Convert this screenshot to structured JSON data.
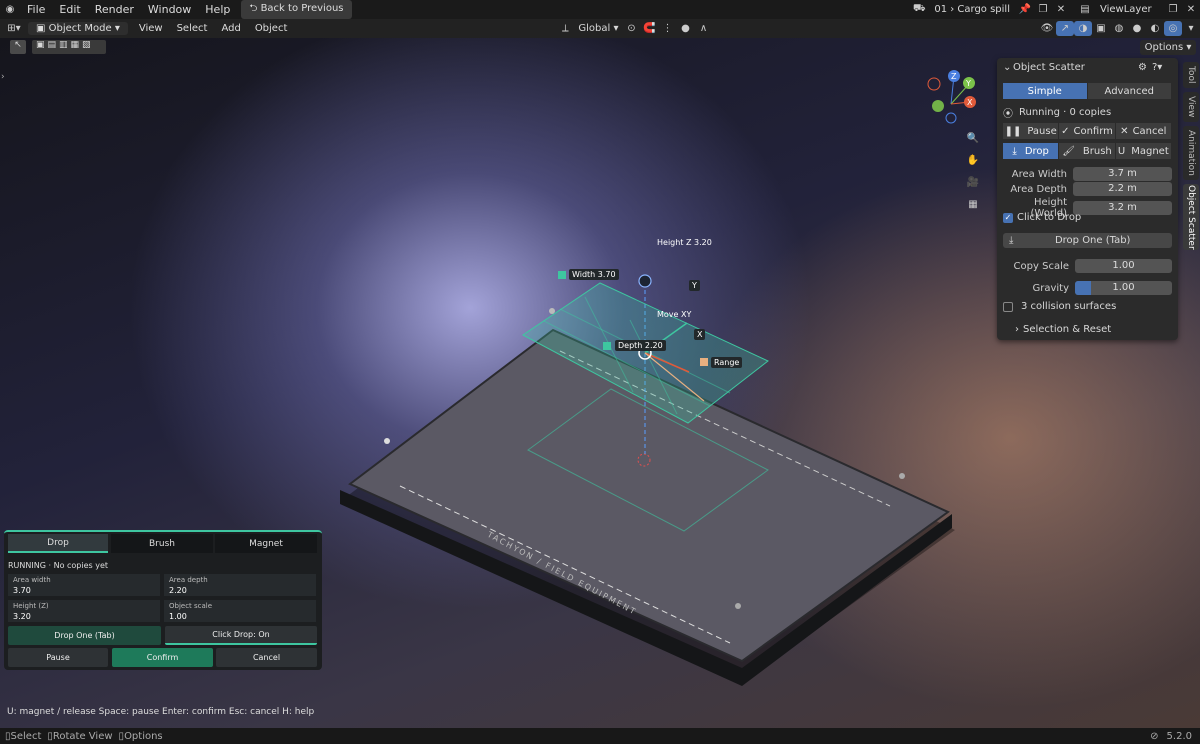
{
  "menu": {
    "items": [
      "File",
      "Edit",
      "Render",
      "Window",
      "Help"
    ],
    "back_button": "Back to Previous",
    "scene": "01 › Cargo spill",
    "view_layer": "ViewLayer"
  },
  "header": {
    "mode": "Object Mode",
    "menus": [
      "View",
      "Select",
      "Add",
      "Object"
    ],
    "orientation": "Global",
    "options": "Options"
  },
  "panel": {
    "title": "Object Scatter",
    "tabs": [
      "Simple",
      "Advanced"
    ],
    "running": "Running · 0 copies",
    "actions": [
      "Pause",
      "Confirm",
      "Cancel"
    ],
    "modes": [
      "Drop",
      "Brush",
      "Magnet"
    ],
    "fields": [
      {
        "label": "Area Width",
        "value": "3.7 m"
      },
      {
        "label": "Area Depth",
        "value": "2.2 m"
      },
      {
        "label": "Height (World)",
        "value": "3.2 m"
      }
    ],
    "click_to_drop": "Click to Drop",
    "drop_one": "Drop One (Tab)",
    "copy_scale": {
      "label": "Copy Scale",
      "value": "1.00"
    },
    "gravity": {
      "label": "Gravity",
      "value": "1.00",
      "fraction": 0.16
    },
    "collision": "3 collision surfaces",
    "selection_reset": "Selection & Reset"
  },
  "side_tabs": [
    "Tool",
    "View",
    "Animation",
    "Object Scatter"
  ],
  "gizmo": {
    "height": "Height Z 3.20",
    "width": "Width 3.70",
    "depth": "Depth 2.20",
    "move": "Move XY",
    "x": "X",
    "y": "Y",
    "range": "Range"
  },
  "board_text": "TACHYON / FIELD EQUIPMENT",
  "overlay": {
    "tabs": [
      "Drop",
      "Brush",
      "Magnet"
    ],
    "status": "RUNNING",
    "status_sub": "No copies yet",
    "cells": [
      {
        "label": "Area width",
        "value": "3.70"
      },
      {
        "label": "Area depth",
        "value": "2.20"
      },
      {
        "label": "Height (Z)",
        "value": "3.20"
      },
      {
        "label": "Object scale",
        "value": "1.00"
      }
    ],
    "drop_one": "Drop One (Tab)",
    "click_drop": "Click Drop: On",
    "pause": "Pause",
    "confirm": "Confirm",
    "cancel": "Cancel"
  },
  "hint": "U: magnet / release Space: pause Enter: confirm Esc: cancel H: help",
  "status": {
    "select": "Select",
    "rotate": "Rotate View",
    "options": "Options",
    "version": "5.2.0"
  },
  "axes": {
    "z": "Z",
    "y": "Y",
    "x": "X"
  }
}
